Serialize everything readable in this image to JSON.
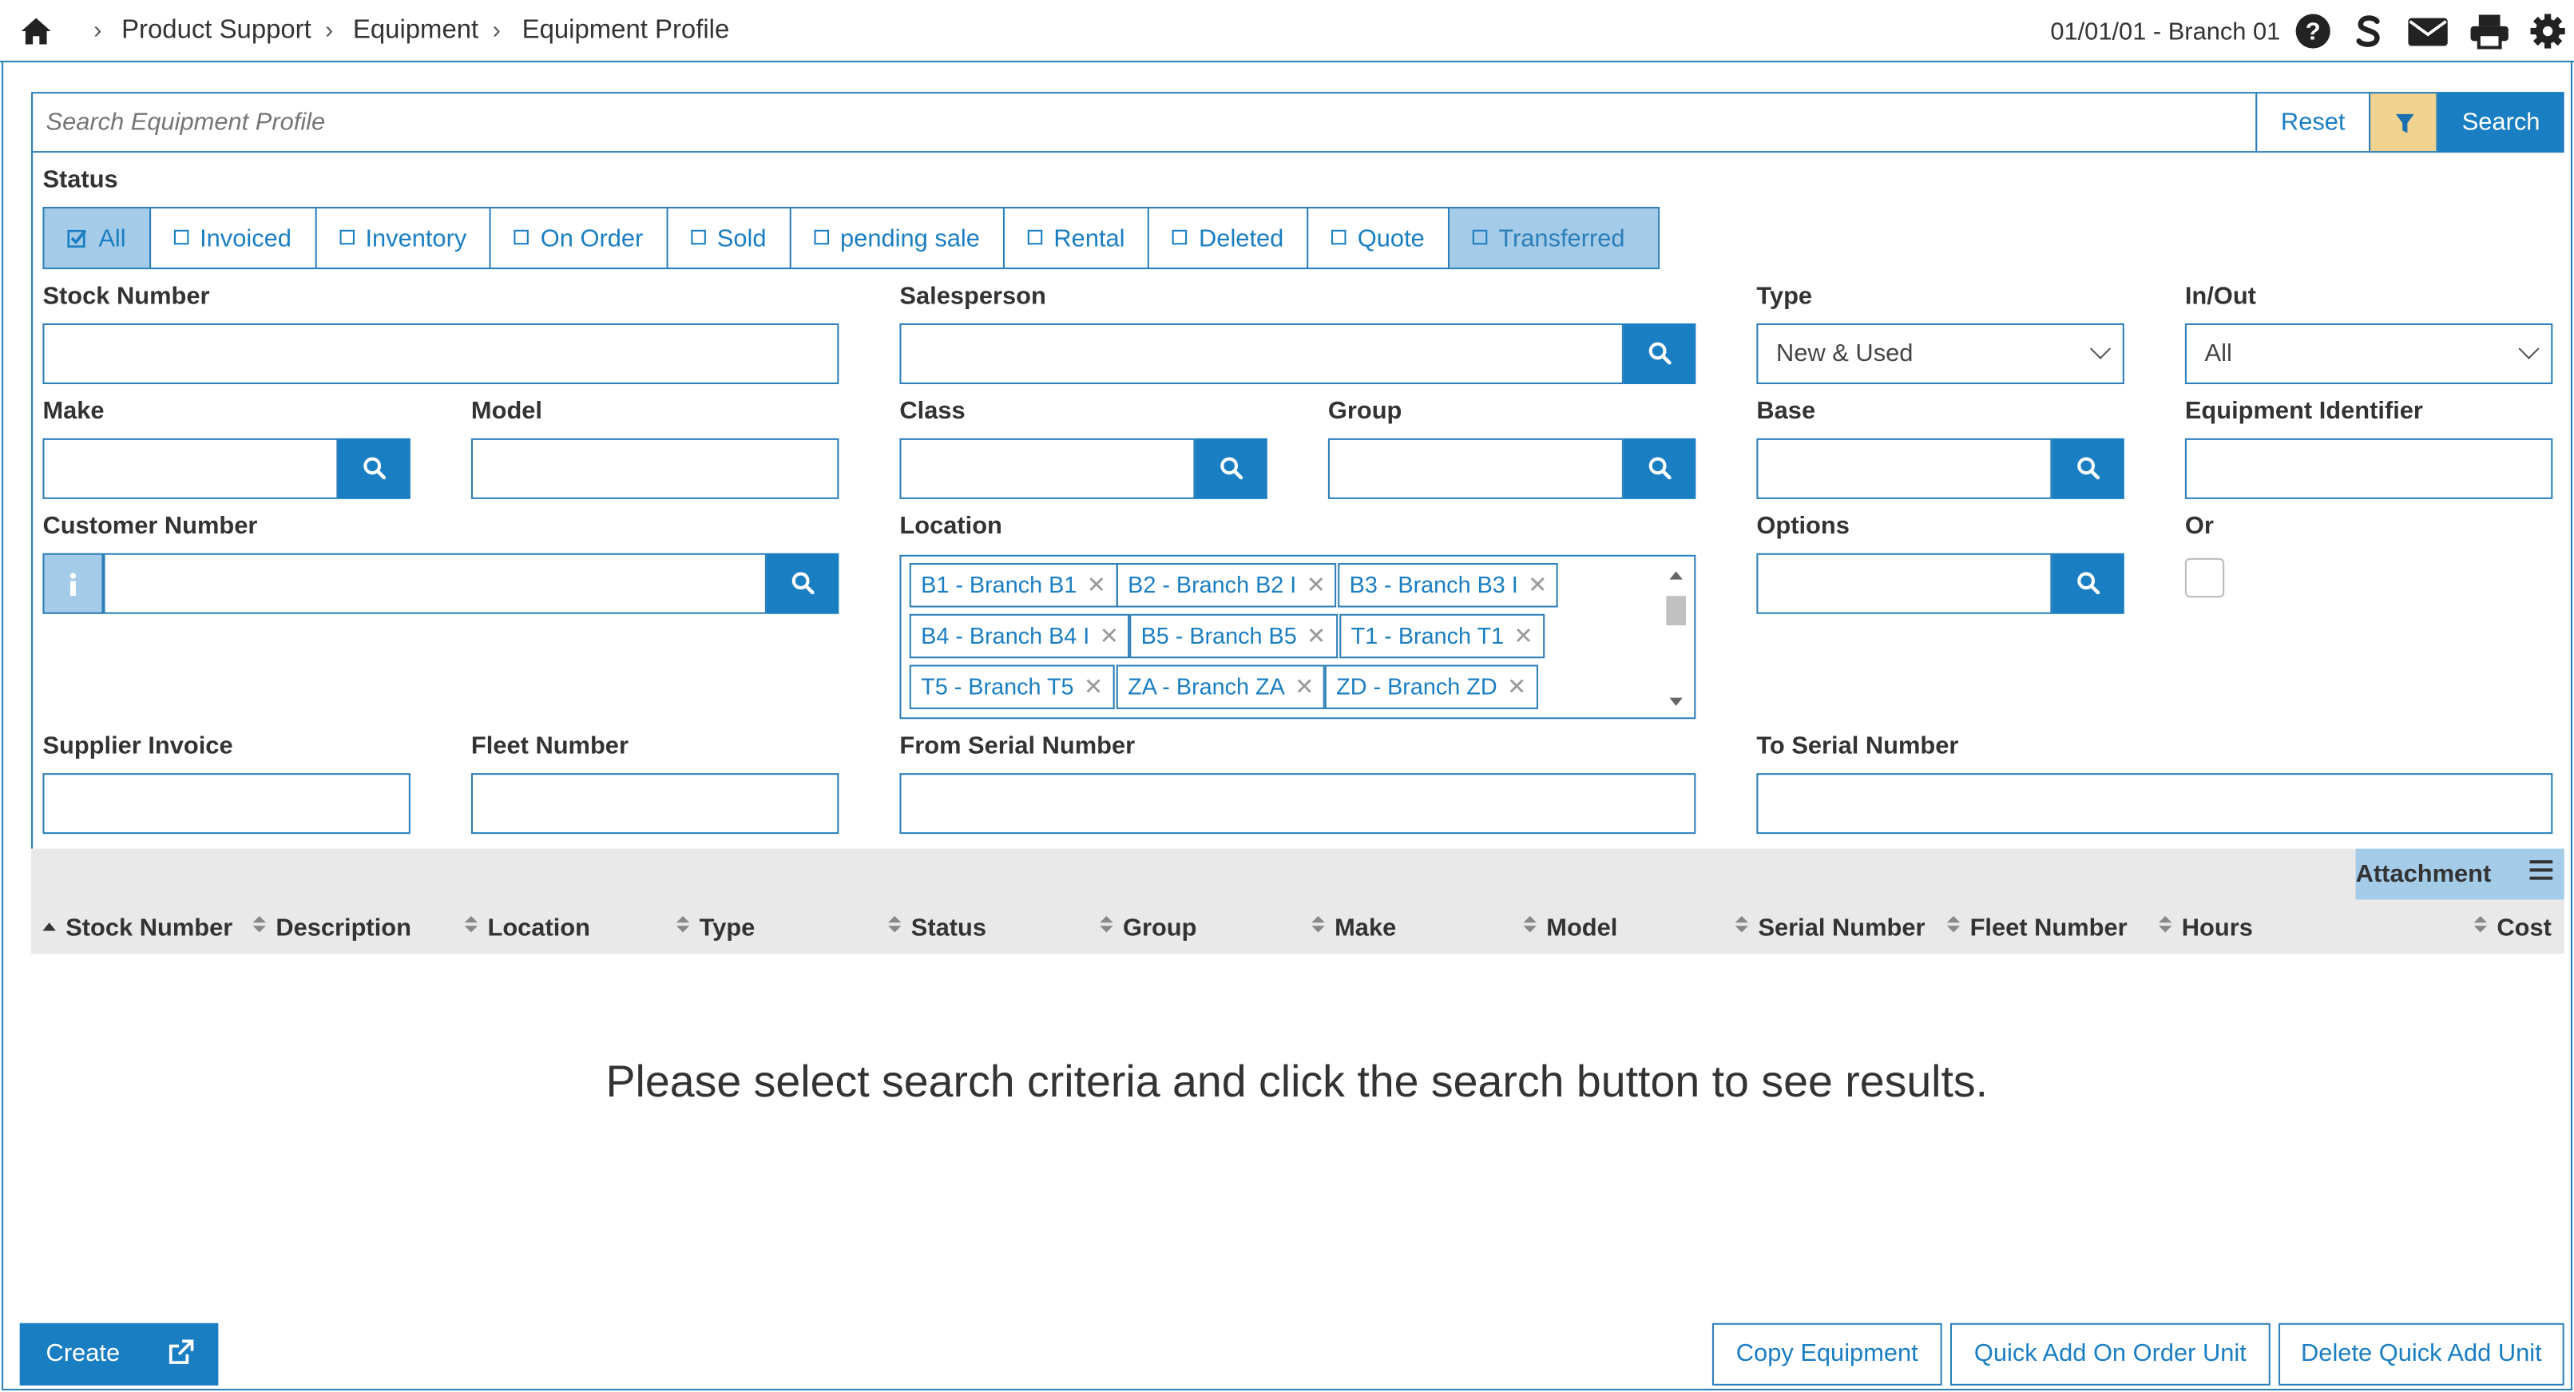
{
  "breadcrumb": {
    "items": [
      "Product Support",
      "Equipment",
      "Equipment Profile"
    ]
  },
  "header": {
    "branch": "01/01/01 - Branch 01"
  },
  "search": {
    "placeholder": "Search Equipment Profile",
    "reset_label": "Reset",
    "search_label": "Search"
  },
  "status": {
    "label": "Status",
    "options": [
      {
        "label": "All",
        "checked": true
      },
      {
        "label": "Invoiced",
        "checked": false
      },
      {
        "label": "Inventory",
        "checked": false
      },
      {
        "label": "On Order",
        "checked": false
      },
      {
        "label": "Sold",
        "checked": false
      },
      {
        "label": "pending sale",
        "checked": false
      },
      {
        "label": "Rental",
        "checked": false
      },
      {
        "label": "Deleted",
        "checked": false
      },
      {
        "label": "Quote",
        "checked": false
      },
      {
        "label": "Transferred",
        "checked": false
      }
    ]
  },
  "fields": {
    "stock_number": "Stock Number",
    "salesperson": "Salesperson",
    "type": {
      "label": "Type",
      "value": "New & Used"
    },
    "inout": {
      "label": "In/Out",
      "value": "All"
    },
    "make": "Make",
    "model": "Model",
    "class": "Class",
    "group": "Group",
    "base": "Base",
    "equipment_identifier": "Equipment Identifier",
    "customer_number": "Customer Number",
    "location": "Location",
    "options": "Options",
    "or": "Or",
    "supplier_invoice": "Supplier Invoice",
    "fleet_number": "Fleet Number",
    "from_serial": "From Serial Number",
    "to_serial": "To Serial Number"
  },
  "location_tags": [
    "B1 - Branch B1",
    "B2 - Branch B2 I",
    "B3 - Branch B3 I",
    "B4 - Branch B4 I",
    "B5 - Branch B5",
    "T1 - Branch T1",
    "T5 - Branch T5",
    "ZA - Branch ZA",
    "ZD - Branch ZD"
  ],
  "table": {
    "attachment_label": "Attachment",
    "columns": [
      "Stock Number",
      "Description",
      "Location",
      "Type",
      "Status",
      "Group",
      "Make",
      "Model",
      "Serial Number",
      "Fleet Number",
      "Hours",
      "Cost"
    ],
    "empty_message": "Please select search criteria and click the search button to see results."
  },
  "footer": {
    "create_label": "Create",
    "copy_label": "Copy Equipment",
    "quick_add_label": "Quick Add On Order Unit",
    "delete_quick_label": "Delete Quick Add Unit"
  },
  "colors": {
    "primary": "#1a7ec2",
    "border": "#2b7fb9",
    "highlight": "#a4cbe8",
    "filter": "#f0d38e"
  },
  "icons": {
    "home": "home-icon",
    "help": "help-icon",
    "s_logo": "s-logo-icon",
    "mail": "mail-icon",
    "print": "print-icon",
    "settings": "gear-icon"
  }
}
